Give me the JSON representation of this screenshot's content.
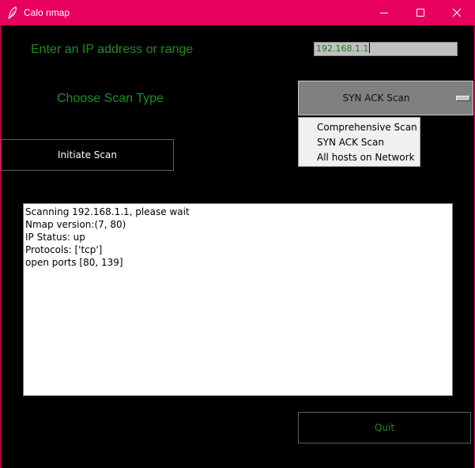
{
  "window": {
    "title": "Calo nmap",
    "icon": "feather-icon",
    "controls": [
      "minimize-icon",
      "maximize-icon",
      "close-icon"
    ],
    "titlebar_color": "#e8005f"
  },
  "form": {
    "ip_label": "Enter an IP address or range",
    "ip_value": "192.168.1.1",
    "scan_type_label": "Choose Scan Type",
    "scan_type_selected": "SYN ACK Scan",
    "scan_type_options": [
      "Comprehensive Scan",
      "SYN ACK Scan",
      "All hosts on Network"
    ],
    "initiate_label": "Initiate Scan",
    "quit_label": "Quit",
    "label_color": "#228b22"
  },
  "output": {
    "lines": [
      "Scanning 192.168.1.1, please wait",
      "Nmap version:(7, 80)",
      "IP Status: up",
      "Protocols: ['tcp']",
      "open ports [80, 139]"
    ]
  }
}
